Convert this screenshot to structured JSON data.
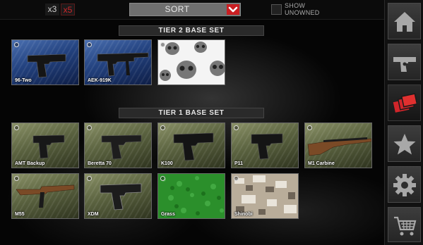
{
  "topbar": {
    "multipliers": [
      {
        "label": "x3",
        "active": false
      },
      {
        "label": "x5",
        "active": true
      }
    ],
    "sort": {
      "label": "SORT"
    },
    "show_unowned": {
      "label_line1": "SHOW",
      "label_line2": "UNOWNED",
      "checked": false
    }
  },
  "sidebar": {
    "items": [
      {
        "icon": "home-icon",
        "selected": false
      },
      {
        "icon": "pistol-icon",
        "selected": false
      },
      {
        "icon": "camo-cards-icon",
        "selected": true
      },
      {
        "icon": "star-icon",
        "selected": false
      },
      {
        "icon": "gear-icon",
        "selected": false
      },
      {
        "icon": "shopping-cart-icon",
        "selected": false
      }
    ]
  },
  "sections": [
    {
      "title": "TIER 2 BASE SET",
      "cards": [
        {
          "name": "96-Two",
          "type": "pistol",
          "bg": "blue"
        },
        {
          "name": "AEK-919K",
          "type": "smg",
          "bg": "blue"
        },
        {
          "name": "",
          "type": "skull-camo",
          "bg": "skull"
        }
      ]
    },
    {
      "title": "TIER 1 BASE SET",
      "cards": [
        {
          "name": "AMT Backup",
          "type": "pistol",
          "bg": "olive"
        },
        {
          "name": "Beretta 70",
          "type": "pistol",
          "bg": "olive"
        },
        {
          "name": "K100",
          "type": "pistol",
          "bg": "olive"
        },
        {
          "name": "P11",
          "type": "pistol",
          "bg": "olive"
        },
        {
          "name": "M1 Carbine",
          "type": "rifle",
          "bg": "olive"
        },
        {
          "name": "M55",
          "type": "smg",
          "bg": "olive"
        },
        {
          "name": "XDM",
          "type": "pistol",
          "bg": "olive"
        },
        {
          "name": "Grass",
          "type": "grass-camo",
          "bg": "grass"
        },
        {
          "name": "Shinobi",
          "type": "snow-camo",
          "bg": "snow"
        }
      ]
    }
  ],
  "colors": {
    "accent": "#c91e22",
    "panel": "#2a2a2a"
  }
}
